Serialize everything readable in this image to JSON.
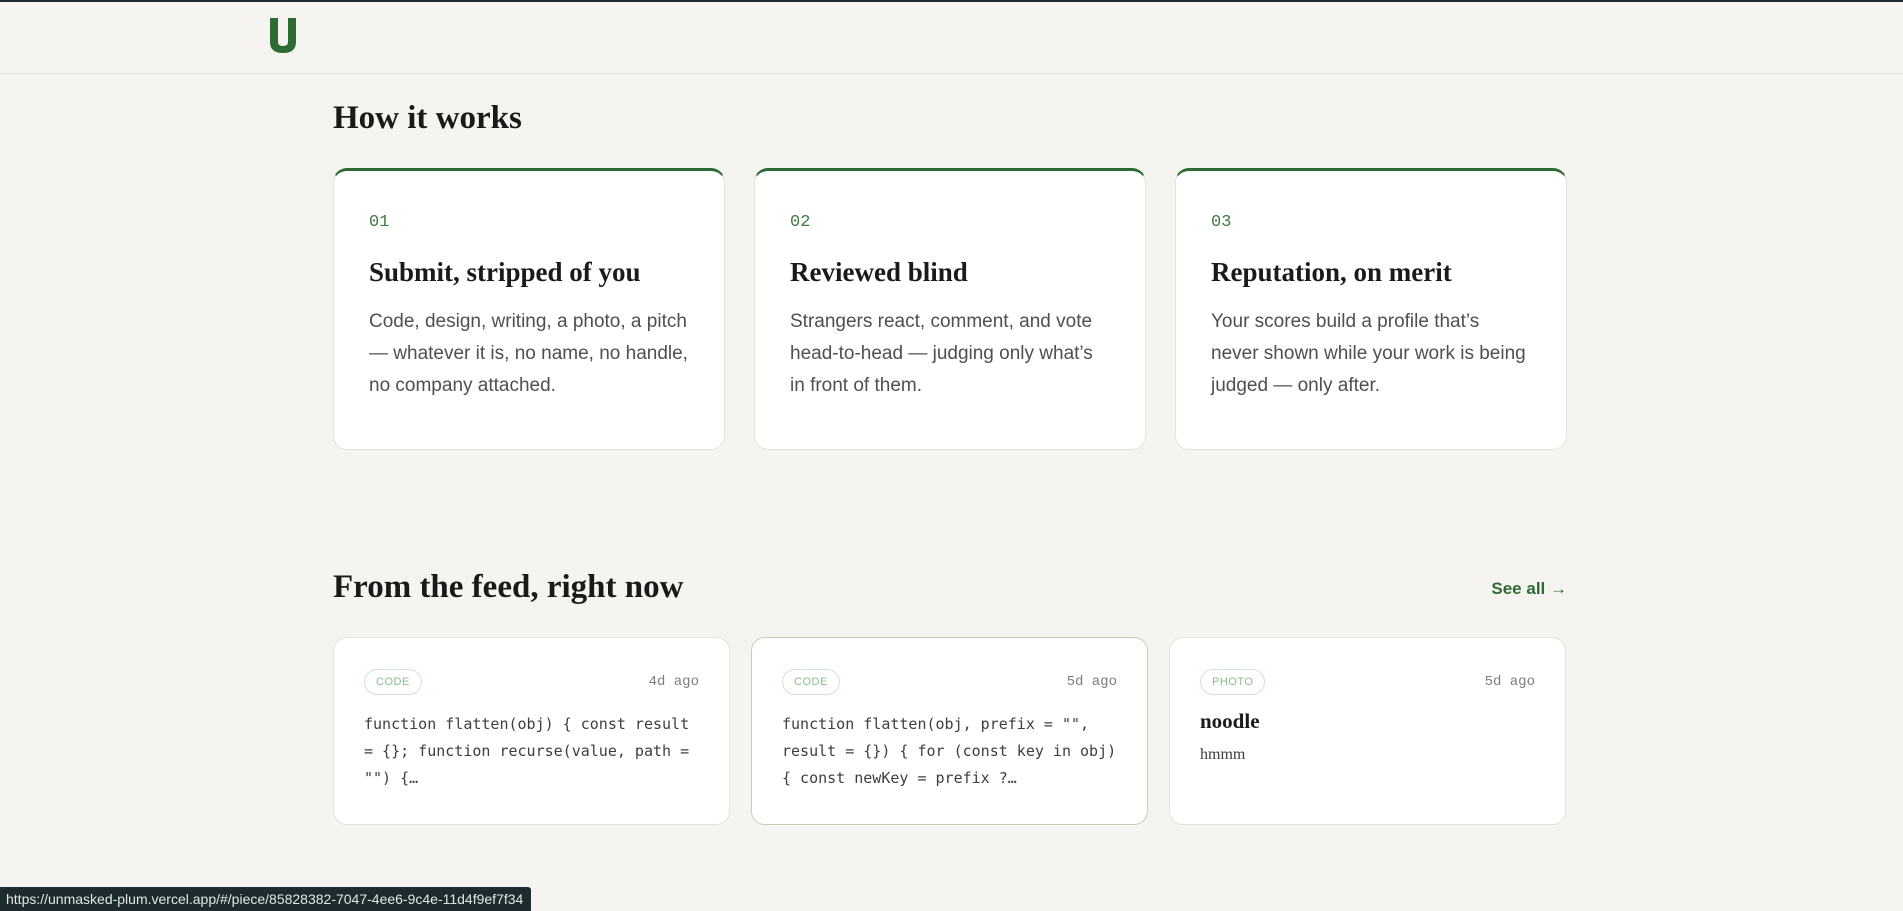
{
  "brand": {
    "logo_color": "#2e6a33"
  },
  "how_it_works": {
    "title": "How it works",
    "steps": [
      {
        "num": "01",
        "title": "Submit, stripped of you",
        "body": "Code, design, writing, a photo, a pitch — whatever it is, no name, no handle, no company attached."
      },
      {
        "num": "02",
        "title": "Reviewed blind",
        "body": "Strangers react, comment, and vote head-to-head — judging only what’s in front of them."
      },
      {
        "num": "03",
        "title": "Reputation, on merit",
        "body": "Your scores build a profile that’s never shown while your work is being judged — only after."
      }
    ]
  },
  "feed": {
    "title": "From the feed, right now",
    "see_all": "See all →",
    "items": [
      {
        "tag": "CODE",
        "ago": "4d ago",
        "snippet": "function flatten(obj) { const result = {}; function recurse(value, path = \"\") {…"
      },
      {
        "tag": "CODE",
        "ago": "5d ago",
        "snippet": "function flatten(obj, prefix = \"\", result = {}) { for (const key in obj) { const newKey = prefix ?…"
      },
      {
        "tag": "PHOTO",
        "ago": "5d ago",
        "title": "noodle",
        "text": "hmmm"
      }
    ]
  },
  "status_bar": {
    "url": "https://unmasked-plum.vercel.app/#/piece/85828382-7047-4ee6-9c4e-11d4f9ef7f34"
  }
}
